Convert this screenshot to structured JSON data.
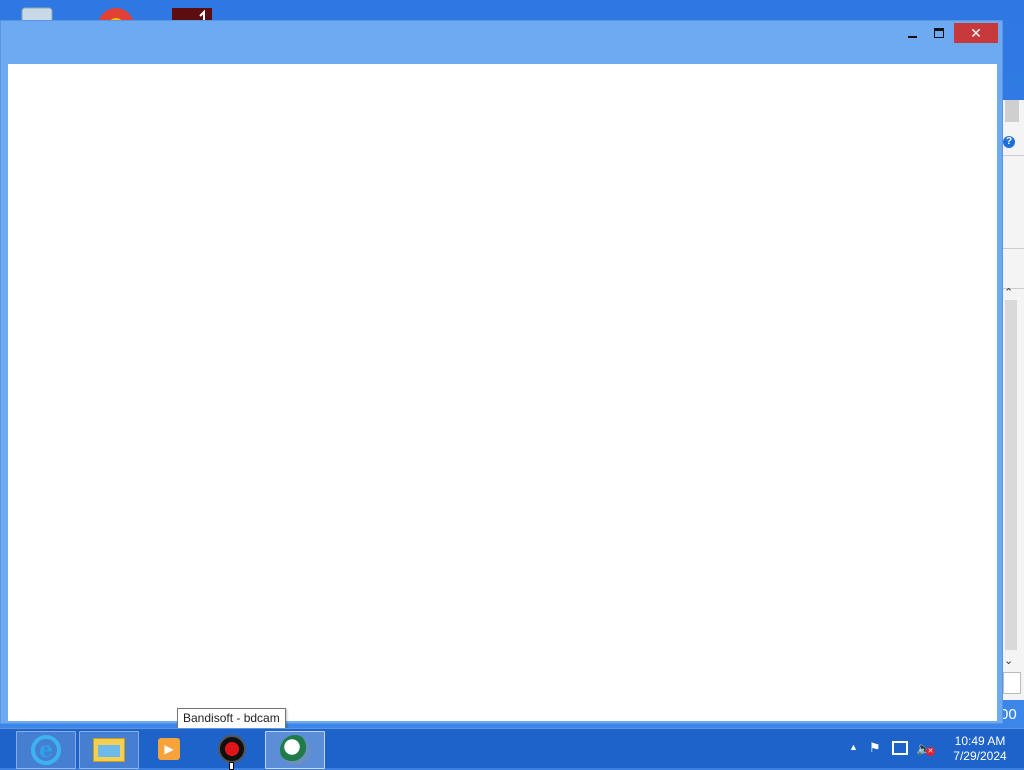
{
  "tooltip": {
    "text": "Bandisoft - bdcam"
  },
  "window": {
    "minimize_glyph": "",
    "close_glyph": "✕"
  },
  "background_window": {
    "help_glyph": "?",
    "partial_value": "00"
  },
  "taskbar": {
    "items": [
      {
        "name": "internet-explorer",
        "glyph": "e"
      },
      {
        "name": "file-explorer"
      },
      {
        "name": "media-player",
        "glyph": "▶"
      },
      {
        "name": "bandicam-recorder"
      },
      {
        "name": "active-app"
      }
    ]
  },
  "tray": {
    "show_hidden_glyph": "▲",
    "time": "10:49 AM",
    "date": "7/29/2024"
  },
  "colors": {
    "desktop": "#3b7fe0",
    "window_frame": "#6eaaf2",
    "taskbar": "#1e63c9",
    "close_button": "#c7393b"
  }
}
